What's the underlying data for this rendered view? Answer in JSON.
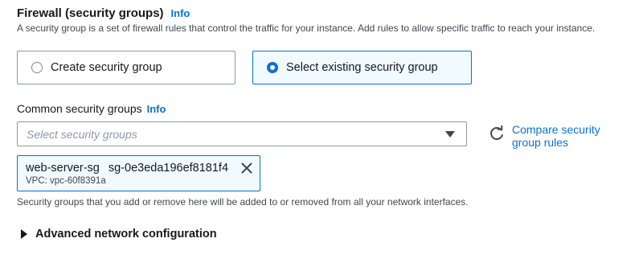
{
  "section": {
    "title": "Firewall (security groups)",
    "info_label": "Info",
    "description": "A security group is a set of firewall rules that control the traffic for your instance. Add rules to allow specific traffic to reach your instance."
  },
  "radio_options": [
    {
      "label": "Create security group",
      "selected": false
    },
    {
      "label": "Select existing security group",
      "selected": true
    }
  ],
  "common_groups": {
    "label": "Common security groups",
    "info_label": "Info",
    "placeholder": "Select security groups",
    "compare_link": "Compare security group rules"
  },
  "selected_group": {
    "name": "web-server-sg",
    "id": "sg-0e3eda196ef8181f4",
    "vpc": "VPC: vpc-60f8391a"
  },
  "help_text": "Security groups that you add or remove here will be added to or removed from all your network interfaces.",
  "advanced": {
    "label": "Advanced network configuration"
  },
  "icons": {
    "select_caret": "caret-down-icon",
    "refresh": "refresh-icon",
    "dismiss": "close-icon",
    "expand": "caret-right-icon"
  },
  "colors": {
    "link": "#0972d3",
    "selected_bg": "#f1faff",
    "text": "#16191f"
  }
}
